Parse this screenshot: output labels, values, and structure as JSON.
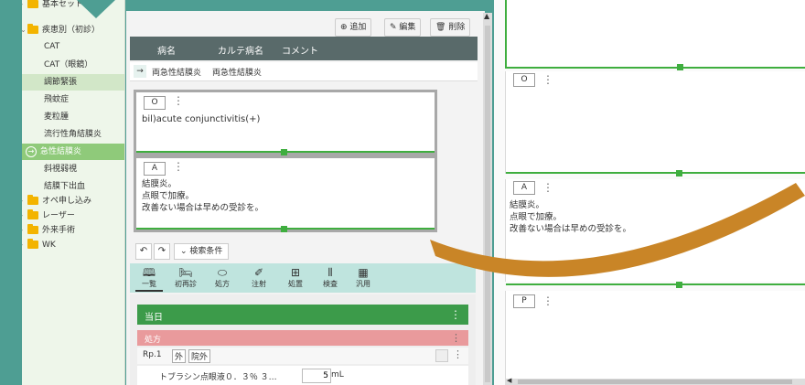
{
  "tree": {
    "items": [
      {
        "label": "基本セット",
        "kind": "folder"
      },
      {
        "label": "疾患別（初診）",
        "kind": "folder-open"
      },
      {
        "label": "CAT",
        "kind": "leaf"
      },
      {
        "label": "CAT（眼鏡）",
        "kind": "leaf"
      },
      {
        "label": "調節緊張",
        "kind": "leaf-selected"
      },
      {
        "label": "飛蚊症",
        "kind": "leaf"
      },
      {
        "label": "麦粒腫",
        "kind": "leaf"
      },
      {
        "label": "流行性角結膜炎",
        "kind": "leaf"
      },
      {
        "label": "急性結膜炎",
        "kind": "leaf-active"
      },
      {
        "label": "斜視弱視",
        "kind": "leaf"
      },
      {
        "label": "結膜下出血",
        "kind": "leaf"
      },
      {
        "label": "オペ申し込み",
        "kind": "folder"
      },
      {
        "label": "レーザー",
        "kind": "folder"
      },
      {
        "label": "外来手術",
        "kind": "folder"
      },
      {
        "label": "WK",
        "kind": "folder"
      }
    ]
  },
  "actions": {
    "add": "追加",
    "edit": "編集",
    "delete": "削除"
  },
  "table": {
    "headers": [
      "病名",
      "カルテ病名",
      "コメント"
    ],
    "row": {
      "disease": "両急性結膜炎",
      "chart_disease": "両急性結膜炎",
      "comment": ""
    }
  },
  "cards": {
    "o": {
      "tag": "O",
      "text": "bil)acute conjunctivitis(+)"
    },
    "a": {
      "tag": "A",
      "lines": [
        "結膜炎。",
        "点眼で加療。",
        "改善ない場合は早めの受診を。"
      ]
    }
  },
  "search": {
    "label": "検索条件"
  },
  "tabs": [
    {
      "label": "一覧",
      "icon": "book-icon",
      "active": true
    },
    {
      "label": "初再診",
      "icon": "bed-icon"
    },
    {
      "label": "処方",
      "icon": "pill-icon"
    },
    {
      "label": "注射",
      "icon": "syringe-icon"
    },
    {
      "label": "処置",
      "icon": "kit-icon"
    },
    {
      "label": "検査",
      "icon": "test-tube-icon"
    },
    {
      "label": "汎用",
      "icon": "grid-icon"
    }
  ],
  "orders": {
    "today": "当日",
    "rx": "処方",
    "rp": {
      "label": "Rp.1",
      "tag1": "外",
      "tag2": "院外"
    },
    "drug": {
      "name": "トブラシン点眼液０．３％ ３…",
      "qty": "5",
      "unit": "mL"
    }
  },
  "right": {
    "o_tag": "O",
    "a_tag": "A",
    "a_lines": [
      "結膜炎。",
      "点眼で加療。",
      "改善ない場合は早めの受診を。"
    ],
    "p_tag": "P"
  },
  "colors": {
    "teal": "#4e9e93",
    "green": "#3fae3f",
    "today": "#3c9b4a",
    "rx": "#e99a9c",
    "arrow": "#c98527"
  }
}
